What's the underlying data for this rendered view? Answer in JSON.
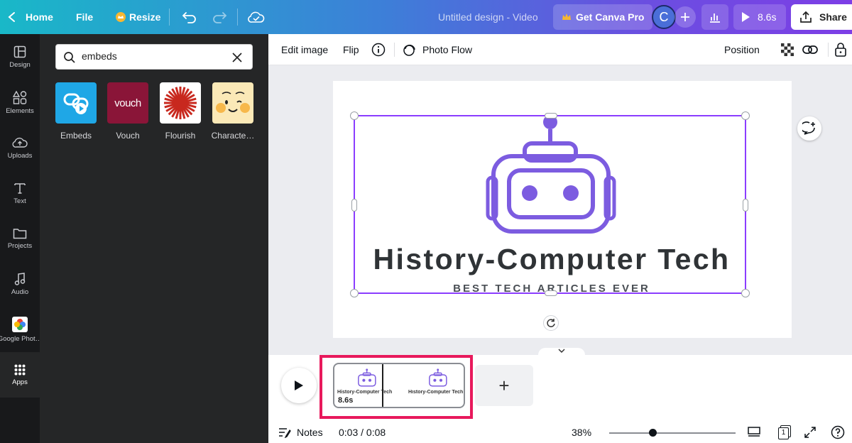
{
  "topbar": {
    "home_label": "Home",
    "file_label": "File",
    "resize_label": "Resize",
    "doc_title": "Untitled design - Video",
    "pro_label": "Get Canva Pro",
    "avatar_initial": "C",
    "present_duration": "8.6s",
    "share_label": "Share"
  },
  "rail": {
    "items": [
      {
        "label": "Design",
        "icon": "layout-icon"
      },
      {
        "label": "Elements",
        "icon": "shapes-icon"
      },
      {
        "label": "Uploads",
        "icon": "cloud-upload-icon"
      },
      {
        "label": "Text",
        "icon": "text-icon"
      },
      {
        "label": "Projects",
        "icon": "folder-icon"
      },
      {
        "label": "Audio",
        "icon": "music-note-icon"
      },
      {
        "label": "Google Phot…",
        "icon": "google-photos-icon"
      },
      {
        "label": "Apps",
        "icon": "apps-grid-icon",
        "active": true
      }
    ]
  },
  "panel": {
    "search_value": "embeds",
    "apps": [
      {
        "label": "Embeds"
      },
      {
        "label": "Vouch",
        "thumb_text": "vouch"
      },
      {
        "label": "Flourish"
      },
      {
        "label": "Characte…"
      }
    ]
  },
  "context_toolbar": {
    "edit_image": "Edit image",
    "flip": "Flip",
    "photo_flow": "Photo Flow",
    "position": "Position"
  },
  "canvas": {
    "logo_title": "History-Computer Tech",
    "logo_subtitle": "BEST TECH ARTICLES EVER"
  },
  "timeline": {
    "clip_duration": "8.6s",
    "add_page": "+"
  },
  "footer": {
    "notes_label": "Notes",
    "time": "0:03 / 0:08",
    "zoom": "38%",
    "page_count": "1"
  },
  "colors": {
    "brand_purple": "#8b3dff",
    "robot_purple": "#7c5ce0",
    "highlight_red": "#e8195c"
  }
}
